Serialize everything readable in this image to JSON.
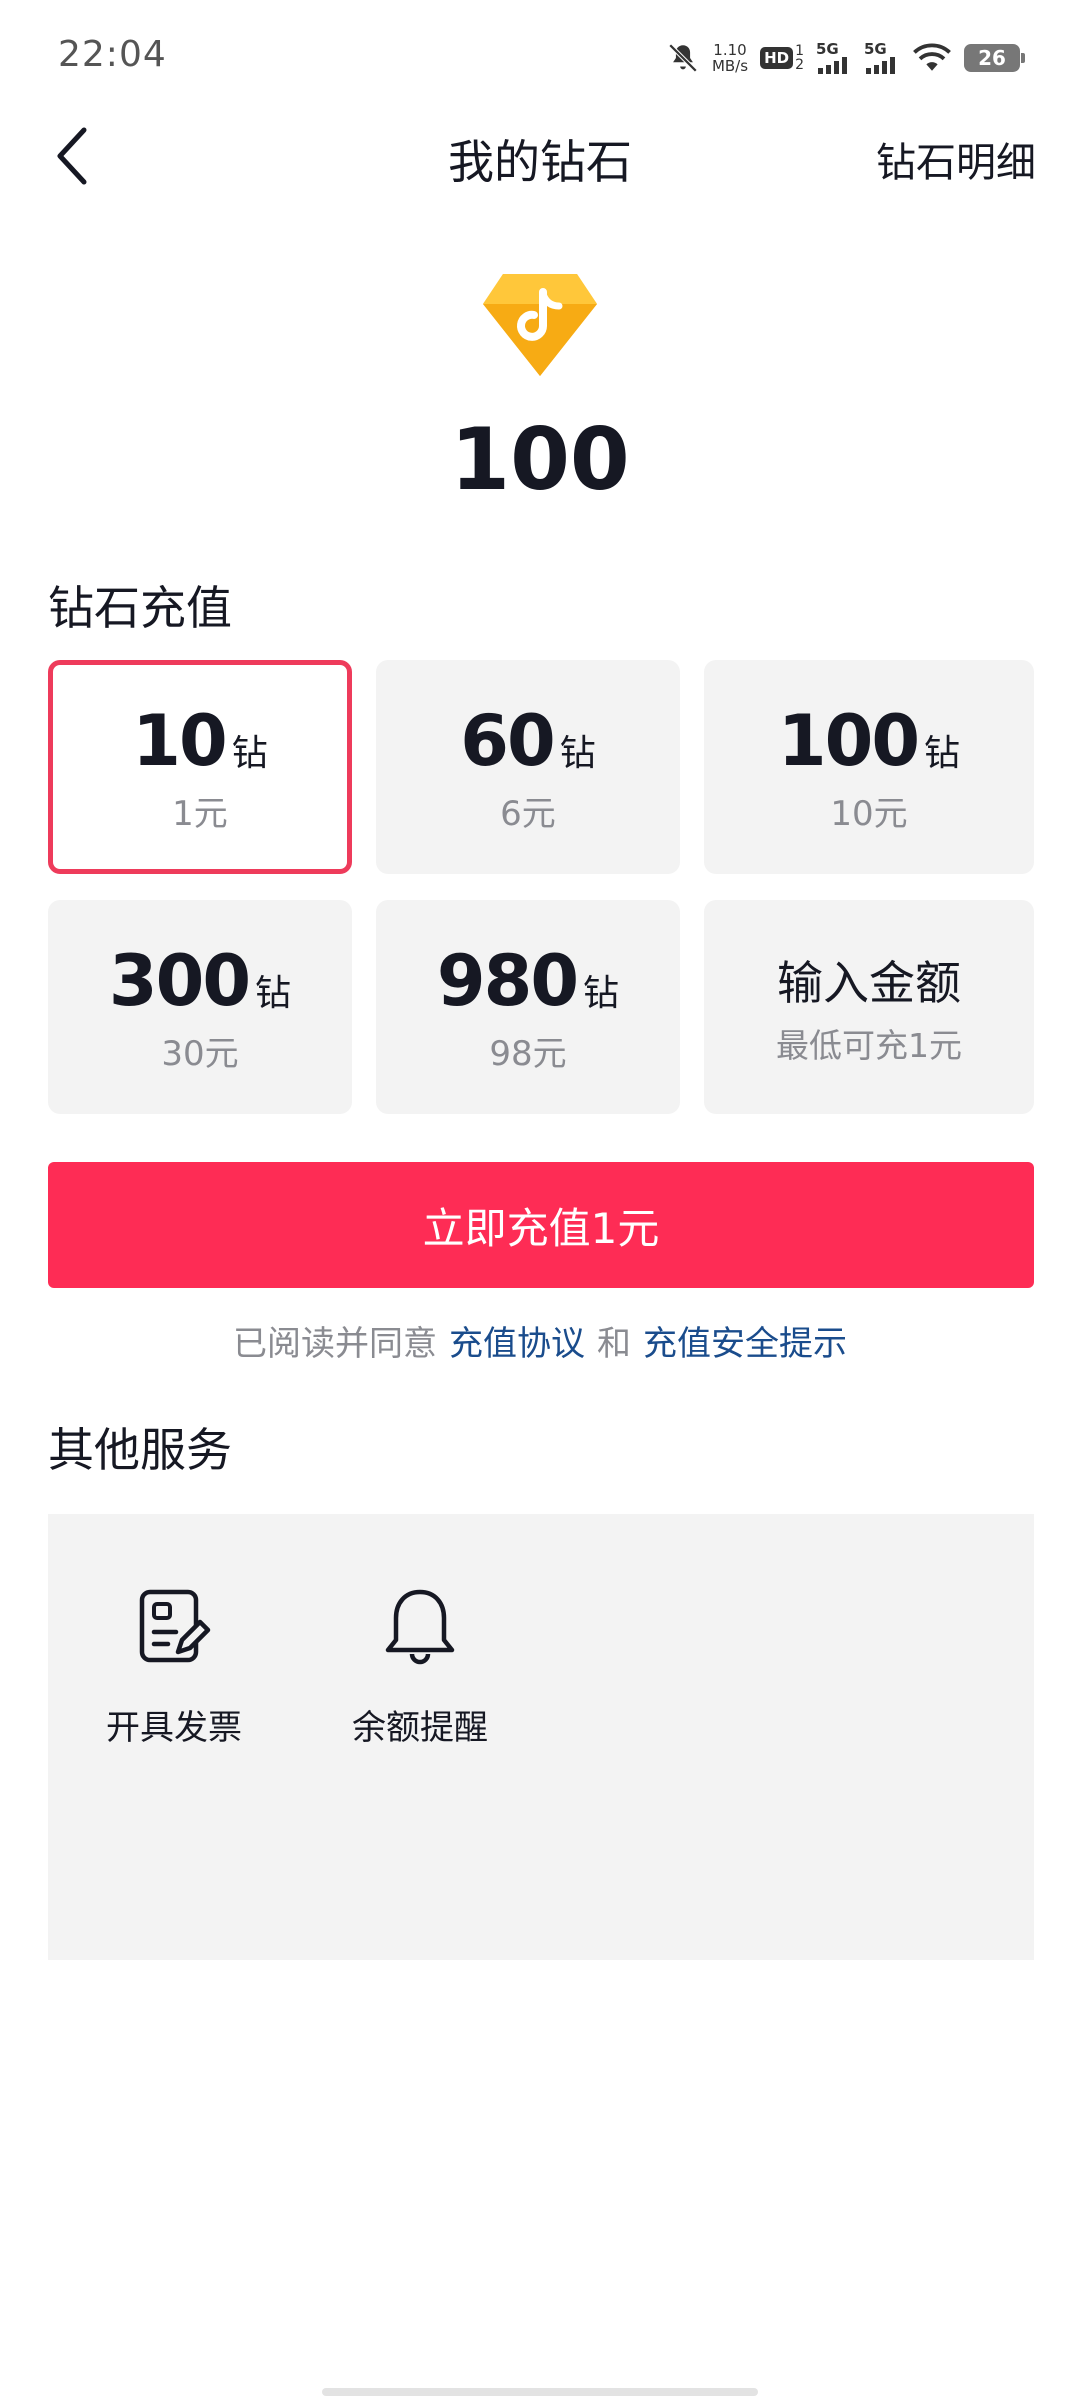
{
  "status_bar": {
    "time": "22:04",
    "net_speed_value": "1.10",
    "net_speed_unit": "MB/s",
    "hd_label": "HD",
    "hd_sub_top": "1",
    "hd_sub_bottom": "2",
    "signal_1": "5G",
    "signal_2": "5G",
    "battery": "26"
  },
  "header": {
    "title": "我的钻石",
    "detail_link": "钻石明细"
  },
  "balance": {
    "value": "100"
  },
  "recharge": {
    "title": "钻石充值",
    "packages": [
      {
        "amount": "10",
        "unit": "钻",
        "price": "1元"
      },
      {
        "amount": "60",
        "unit": "钻",
        "price": "6元"
      },
      {
        "amount": "100",
        "unit": "钻",
        "price": "10元"
      },
      {
        "amount": "300",
        "unit": "钻",
        "price": "30元"
      },
      {
        "amount": "980",
        "unit": "钻",
        "price": "98元"
      }
    ],
    "custom": {
      "title": "输入金额",
      "subtitle": "最低可充1元"
    },
    "selected_index": 0,
    "button_label": "立即充值1元"
  },
  "agreement": {
    "prefix": "已阅读并同意",
    "link_1": "充值协议",
    "conjunction": "和",
    "link_2": "充值安全提示"
  },
  "services": {
    "title": "其他服务",
    "items": [
      {
        "label": "开具发票",
        "icon": "invoice-icon"
      },
      {
        "label": "余额提醒",
        "icon": "bell-icon"
      }
    ]
  },
  "colors": {
    "accent": "#fe2c55",
    "selected_border": "#ee3b5b",
    "link": "#1a4c8c",
    "card_bg": "#f3f3f3"
  }
}
